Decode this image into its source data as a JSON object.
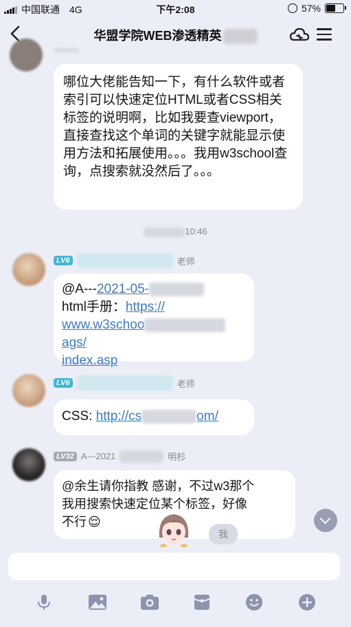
{
  "status_bar": {
    "carrier": "中国联通",
    "network": "4G",
    "time": "下午2:08",
    "battery_text": "57%",
    "battery_level": 0.57
  },
  "nav": {
    "back_icon": "chevron-left-icon",
    "title": "华盟学院WEB渗透精英",
    "cloud_icon": "cloud-sync-icon",
    "menu_icon": "menu-icon"
  },
  "messages": [
    {
      "text": "哪位大佬能告知一下，有什么软件或者索引可以快速定位HTML或者CSS相关标签的说明啊，比如我要查viewport，直接查找这个单词的关键字就能显示使用方法和拓展使用。。。我用w3school查询，点搜索就没然后了。。。"
    }
  ],
  "timestamp": "10:46",
  "reply1": {
    "level": "LV6",
    "role_suffix": "老师",
    "mention": "@A---",
    "mention_link": "2021-05-",
    "manual_label": "html手册：",
    "url_start": "https://",
    "url_line2_a": "www.w3schoo",
    "url_line2_b": "ags/",
    "url_line3": "index.asp"
  },
  "reply2": {
    "level": "LV6",
    "role_suffix": "老师",
    "label": "CSS:",
    "url_a": "http://cs",
    "url_b": "om/"
  },
  "reply3": {
    "level": "LV32",
    "name": "A---2021",
    "name_suffix": "明杉",
    "line1": "@余生请你指教 感谢，不过w3那个",
    "line2": "我用搜索快速定位某个标签，好像",
    "line3": "不行",
    "emoji": "😌"
  },
  "me_chip": "我",
  "toolbar_icons": [
    "microphone-icon",
    "image-icon",
    "camera-icon",
    "red-packet-icon",
    "emoji-icon",
    "plus-icon"
  ]
}
